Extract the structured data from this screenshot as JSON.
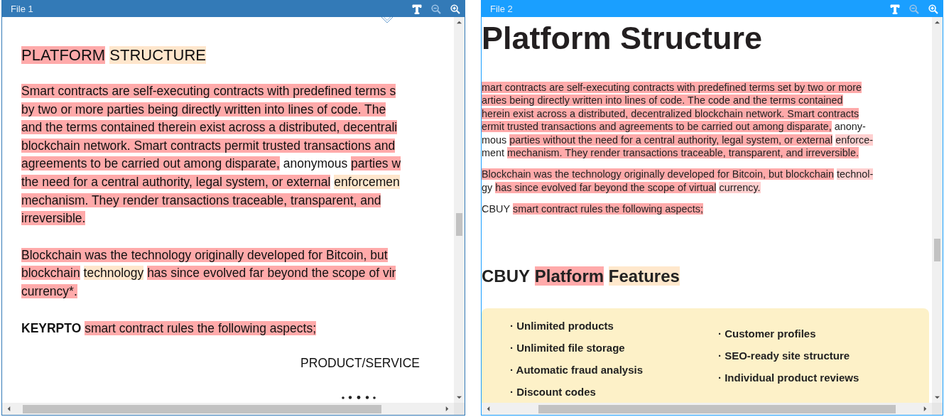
{
  "panels": [
    {
      "title": "File 1",
      "kind": "document",
      "tools": [
        {
          "kind": "text",
          "disabled": false
        },
        {
          "kind": "zoom-out",
          "disabled": true
        },
        {
          "kind": "zoom-in",
          "disabled": false
        }
      ],
      "blocks": [
        {
          "kind": "heading",
          "lines": [
            [
              {
                "text": "PLATFORM",
                "kind": "deleted"
              },
              {
                "text": "STRUCTURE",
                "kind": "changed"
              }
            ]
          ]
        },
        {
          "kind": "paragraph",
          "lines": [
            [
              {
                "text": "Smart contracts are self-executing contracts with predefined terms s",
                "kind": "deleted"
              }
            ],
            [
              {
                "text": "by two or more parties being directly written into lines of code. The",
                "kind": "deleted"
              }
            ],
            [
              {
                "text": "and the terms contained therein exist across a distributed, decentrali",
                "kind": "deleted"
              }
            ],
            [
              {
                "text": "blockchain network. Smart contracts permit trusted transactions and",
                "kind": "deleted"
              }
            ],
            [
              {
                "text": "agreements to be carried out among disparate,",
                "kind": "deleted"
              },
              {
                "text": "anonymous",
                "kind": "plain"
              },
              {
                "text": "parties w",
                "kind": "deleted"
              }
            ],
            [
              {
                "text": "the need for a central authority, legal system, or external",
                "kind": "deleted"
              },
              {
                "text": "enforcemen",
                "kind": "changed"
              }
            ],
            [
              {
                "text": "mechanism. They render transactions traceable, transparent, and",
                "kind": "deleted"
              }
            ],
            [
              {
                "text": "irreversible.",
                "kind": "deleted"
              }
            ]
          ]
        },
        {
          "kind": "paragraph",
          "lines": [
            [
              {
                "text": "Blockchain was the technology originally developed for Bitcoin, but",
                "kind": "deleted"
              }
            ],
            [
              {
                "text": "blockchain",
                "kind": "deleted"
              },
              {
                "text": "technology",
                "kind": "changed"
              },
              {
                "text": "has since evolved far beyond the scope of vir",
                "kind": "deleted"
              }
            ],
            [
              {
                "text": "currency*.",
                "kind": "deleted"
              }
            ]
          ]
        },
        {
          "kind": "paragraph",
          "lines": [
            [
              {
                "text": "KEYRPTO",
                "kind": "plain-bold"
              },
              {
                "text": "smart contract rules the following aspects;",
                "kind": "deleted"
              }
            ]
          ]
        },
        {
          "kind": "caption",
          "lines": [
            [
              {
                "text": "PRODUCT/SERVICE",
                "kind": "plain"
              }
            ]
          ]
        }
      ]
    },
    {
      "title": "File 2",
      "kind": "web",
      "tools": [
        {
          "kind": "text",
          "disabled": false
        },
        {
          "kind": "zoom-out",
          "disabled": true
        },
        {
          "kind": "zoom-in",
          "disabled": false
        }
      ],
      "blocks": [
        {
          "kind": "heading",
          "lines": [
            [
              {
                "text": "Platform Structure",
                "kind": "plain"
              }
            ]
          ]
        },
        {
          "kind": "paragraph",
          "lines": [
            [
              {
                "text": "mart contracts are self-executing contracts with predefined terms set by two or more",
                "kind": "deleted"
              }
            ],
            [
              {
                "text": "arties being directly written into lines of code. The code and the terms contained",
                "kind": "deleted"
              }
            ],
            [
              {
                "text": "herein exist across a distributed, decentralized blockchain network. Smart contracts",
                "kind": "deleted"
              }
            ],
            [
              {
                "text": "ermit trusted transactions and agreements to be carried out among disparate,",
                "kind": "deleted"
              },
              {
                "text": "anony-",
                "kind": "plain"
              }
            ],
            [
              {
                "text": "mous",
                "kind": "plain"
              },
              {
                "text": "parties without the need for a central authority, legal system, or external",
                "kind": "deleted"
              },
              {
                "text": "enforce-",
                "kind": "changed"
              }
            ],
            [
              {
                "text": "ment",
                "kind": "plain"
              },
              {
                "text": "mechanism. They render transactions traceable, transparent, and irreversible.",
                "kind": "deleted"
              }
            ]
          ]
        },
        {
          "kind": "paragraph",
          "lines": [
            [
              {
                "text": "Blockchain was the technology originally developed for Bitcoin, but blockchain",
                "kind": "deleted"
              },
              {
                "text": "technol-",
                "kind": "changed"
              }
            ],
            [
              {
                "text": "gy",
                "kind": "plain"
              },
              {
                "text": "has since evolved far beyond the scope of virtual",
                "kind": "deleted"
              },
              {
                "text": "currency.",
                "kind": "changed"
              }
            ]
          ]
        },
        {
          "kind": "paragraph",
          "lines": [
            [
              {
                "text": "CBUY",
                "kind": "plain"
              },
              {
                "text": "smart contract rules the following aspects;",
                "kind": "deleted"
              }
            ]
          ]
        },
        {
          "kind": "subheading",
          "lines": [
            [
              {
                "text": "CBUY",
                "kind": "plain"
              },
              {
                "text": "Platform",
                "kind": "deleted"
              },
              {
                "text": "Features",
                "kind": "changed"
              }
            ]
          ]
        },
        {
          "kind": "features",
          "columns": [
            [
              "· Unlimited products",
              "· Unlimited file storage",
              "· Automatic fraud analysis",
              "· Discount codes"
            ],
            [
              "· Customer profiles",
              "· SEO-ready site structure",
              "· Individual product reviews"
            ]
          ]
        }
      ]
    }
  ]
}
